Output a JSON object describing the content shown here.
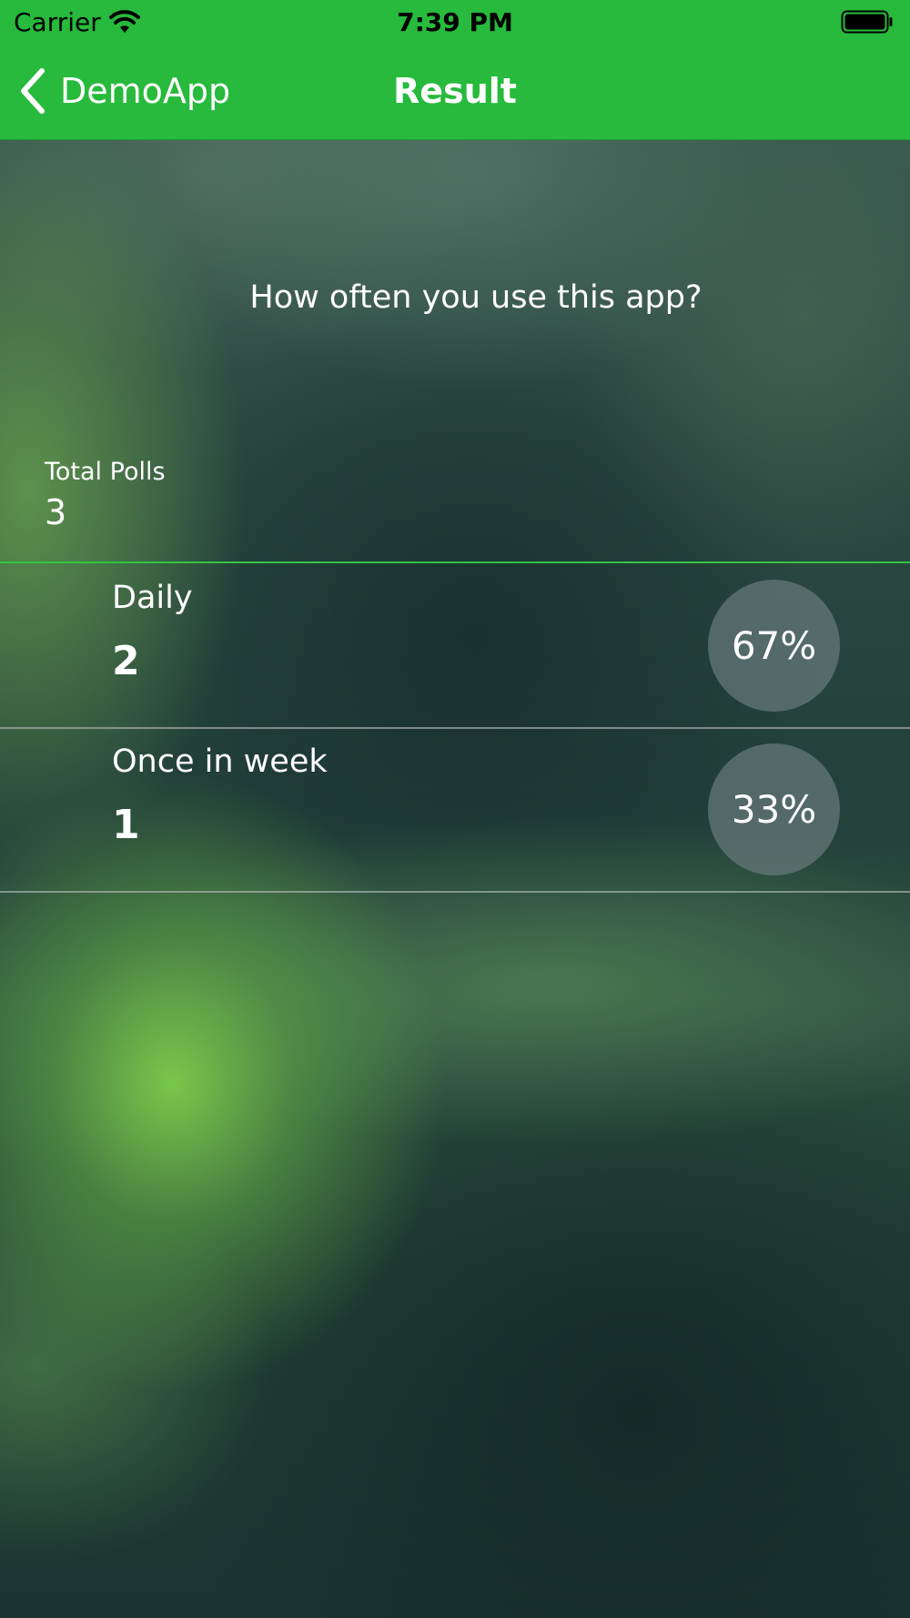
{
  "status_bar": {
    "carrier": "Carrier",
    "time": "7:39 PM"
  },
  "nav": {
    "back_label": "DemoApp",
    "title": "Result"
  },
  "poll": {
    "question": "How often  you use this app?",
    "total_label": "Total Polls",
    "total_value": "3",
    "options": [
      {
        "label": "Daily",
        "count": "2",
        "percent": "67%"
      },
      {
        "label": "Once in week",
        "count": "1",
        "percent": "33%"
      }
    ]
  },
  "colors": {
    "brand_green": "#27ba3c",
    "divider_green": "#2fc642"
  }
}
